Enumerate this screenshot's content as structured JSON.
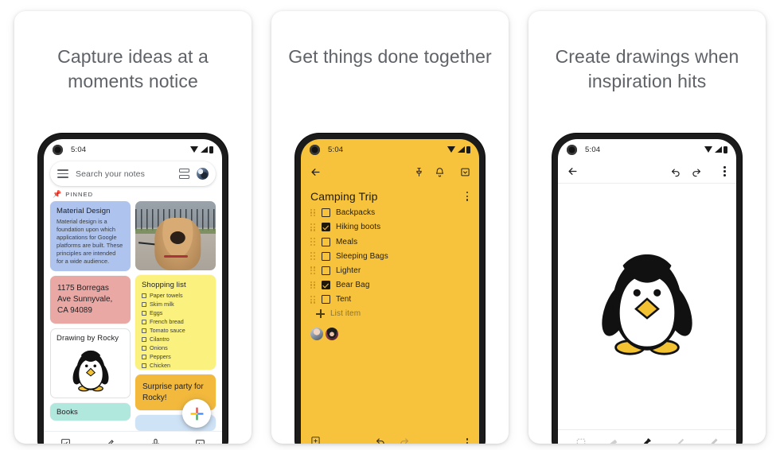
{
  "cards": [
    {
      "headline": "Capture ideas at a moments notice",
      "phone": {
        "status": {
          "time": "5:04",
          "wifi_icon": "wifi-icon",
          "signal_icon": "cellular-signal-icon",
          "battery_icon": "battery-icon"
        },
        "search": {
          "menu_icon": "hamburger-menu-icon",
          "placeholder": "Search your notes",
          "view_toggle_icon": "list-view-toggle-icon",
          "avatar_icon": "account-avatar"
        },
        "pinned": {
          "pin_icon": "pin-icon",
          "label": "PINNED"
        },
        "notes": [
          {
            "id": "material-design",
            "title": "Material Design",
            "body": "Material design is a foundation upon which applications for Google platforms are built. These principles are intended for a wide audience.",
            "color": "#aec3ee"
          },
          {
            "id": "address",
            "title": "",
            "body": "1175 Borregas Ave Sunnyvale, CA 94089",
            "color": "#eaa8a4"
          },
          {
            "id": "drawing-by-rocky",
            "title": "Drawing by Rocky",
            "body": "",
            "color": "#ffffff"
          },
          {
            "id": "books-note",
            "title": "Books",
            "body": "",
            "color": "#b0e8de"
          },
          {
            "id": "dog-photo",
            "title": "",
            "body": "",
            "color": "#9aa3ab"
          },
          {
            "id": "shopping-list",
            "title": "Shopping list",
            "body": "",
            "color": "#fbf17f",
            "items": [
              "Paper towels",
              "Skim milk",
              "Eggs",
              "French bread",
              "Tomato sauce",
              "Cilantro",
              "Onions",
              "Peppers",
              "Chicken"
            ]
          },
          {
            "id": "surprise-party",
            "title": "",
            "body": "Surprise party for Rocky!",
            "color": "#f2b93c"
          }
        ],
        "bottom_tools": [
          {
            "name": "new-checklist-icon",
            "label": "New list"
          },
          {
            "name": "new-drawing-icon",
            "label": "New drawing"
          },
          {
            "name": "new-voice-note-icon",
            "label": "New recording"
          },
          {
            "name": "new-image-note-icon",
            "label": "New image note"
          }
        ],
        "fab": {
          "name": "create-note-fab",
          "label": "Create note",
          "colors": [
            "#ea4335",
            "#fbbc04",
            "#34a853",
            "#4285f4"
          ]
        }
      }
    },
    {
      "headline": "Get things done together",
      "phone": {
        "status": {
          "time": "5:04",
          "wifi_icon": "wifi-icon",
          "signal_icon": "cellular-signal-icon",
          "battery_icon": "battery-icon"
        },
        "background_color": "#f7c33c",
        "appbar": [
          {
            "name": "back-icon",
            "label": "Back"
          },
          {
            "name": "pin-icon",
            "label": "Pin note"
          },
          {
            "name": "reminder-bell-icon",
            "label": "Reminder"
          },
          {
            "name": "archive-icon",
            "label": "Archive"
          }
        ],
        "note_title": "Camping Trip",
        "overflow_icon": "more-options-icon",
        "checklist": [
          {
            "label": "Backpacks",
            "checked": false
          },
          {
            "label": "Hiking boots",
            "checked": true
          },
          {
            "label": "Meals",
            "checked": false
          },
          {
            "label": "Sleeping Bags",
            "checked": false
          },
          {
            "label": "Lighter",
            "checked": false
          },
          {
            "label": "Bear Bag",
            "checked": true
          },
          {
            "label": "Tent",
            "checked": false
          }
        ],
        "add_item_label": "List item",
        "collaborators": [
          "collaborator-avatar-1",
          "collaborator-avatar-2"
        ],
        "bottom_icons": [
          {
            "name": "add-attachment-icon",
            "label": "Add"
          },
          {
            "name": "undo-icon",
            "label": "Undo"
          },
          {
            "name": "redo-icon",
            "label": "Redo"
          },
          {
            "name": "more-options-icon",
            "label": "More"
          }
        ]
      }
    },
    {
      "headline": "Create drawings when inspiration hits",
      "phone": {
        "status": {
          "time": "5:04",
          "wifi_icon": "wifi-icon",
          "signal_icon": "cellular-signal-icon",
          "battery_icon": "battery-icon"
        },
        "appbar": [
          {
            "name": "back-icon",
            "label": "Back"
          },
          {
            "name": "undo-icon",
            "label": "Undo"
          },
          {
            "name": "redo-icon",
            "label": "Redo"
          },
          {
            "name": "more-options-icon",
            "label": "More"
          }
        ],
        "canvas": {
          "name": "penguin-drawing",
          "label": "Penguin drawing"
        },
        "tools": [
          {
            "name": "selection-tool-icon",
            "label": "Select",
            "selected": false
          },
          {
            "name": "eraser-tool-icon",
            "label": "Eraser",
            "selected": false
          },
          {
            "name": "marker-tool-icon",
            "label": "Marker",
            "selected": true
          },
          {
            "name": "pen-tool-icon",
            "label": "Pen",
            "selected": false
          },
          {
            "name": "highlighter-tool-icon",
            "label": "Highlighter",
            "selected": false
          }
        ],
        "selected_indicator_color": "#1a73e8"
      }
    }
  ]
}
